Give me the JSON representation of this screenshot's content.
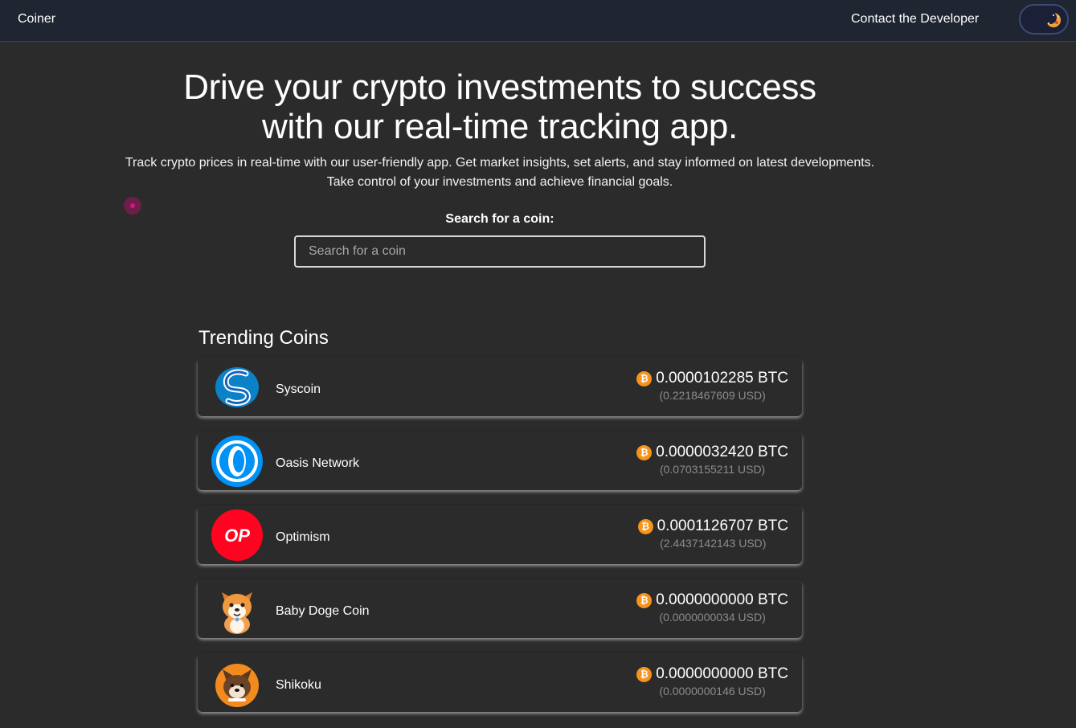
{
  "nav": {
    "brand": "Coiner",
    "contact": "Contact the Developer",
    "theme_toggle_icon": "moon-icon"
  },
  "hero": {
    "title_line1": "Drive your crypto investments to success",
    "title_line2": "with our real-time tracking app.",
    "subtitle_line1": "Track crypto prices in real-time with our user-friendly app. Get market insights, set alerts, and stay informed on latest developments.",
    "subtitle_line2": "Take control of your investments and achieve financial goals."
  },
  "search": {
    "label": "Search for a coin:",
    "placeholder": "Search for a coin",
    "value": ""
  },
  "trending": {
    "title": "Trending Coins",
    "coins": [
      {
        "name": "Syscoin",
        "btc": "0.0000102285 BTC",
        "usd": "(0.2218467609 USD)",
        "icon": "syscoin-logo-icon"
      },
      {
        "name": "Oasis Network",
        "btc": "0.0000032420 BTC",
        "usd": "(0.0703155211 USD)",
        "icon": "oasis-network-logo-icon"
      },
      {
        "name": "Optimism",
        "btc": "0.0001126707 BTC",
        "usd": "(2.4437142143 USD)",
        "icon": "optimism-logo-icon",
        "logo_text": "OP"
      },
      {
        "name": "Baby Doge Coin",
        "btc": "0.0000000000 BTC",
        "usd": "(0.0000000034 USD)",
        "icon": "baby-doge-logo-icon"
      },
      {
        "name": "Shikoku",
        "btc": "0.0000000000 BTC",
        "usd": "(0.0000000146 USD)",
        "icon": "shikoku-logo-icon"
      }
    ],
    "btc_symbol": "₿"
  },
  "colors": {
    "background": "#2b2b2b",
    "navbar": "#1f2631",
    "bitcoin_orange": "#f7931a",
    "optimism_red": "#ff0420",
    "oasis_blue": "#0092f6"
  }
}
